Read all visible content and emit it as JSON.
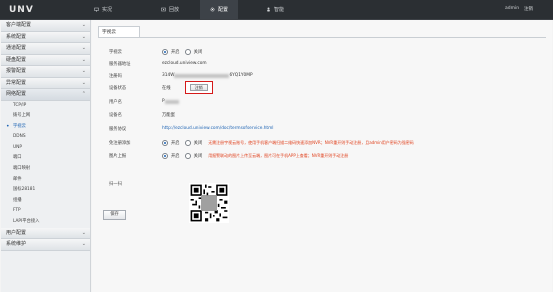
{
  "header": {
    "logo": "UNV",
    "nav": [
      {
        "label": "实况"
      },
      {
        "label": "回放"
      },
      {
        "label": "配置"
      },
      {
        "label": "智能"
      }
    ],
    "user": "admin",
    "logout": "注销"
  },
  "sidebar": {
    "groups_top": [
      "客户端配置",
      "系统配置",
      "通道配置",
      "硬盘配置",
      "报警配置",
      "异常配置",
      "网络配置"
    ],
    "net_items": [
      "TCP/IP",
      "拨号上网",
      "宇视云",
      "DDNS",
      "UNP",
      "端口",
      "端口映射",
      "邮件",
      "国标28181",
      "组播",
      "FTP",
      "LAPI平台接入"
    ],
    "groups_bottom": [
      "用户配置",
      "系统维护"
    ]
  },
  "main": {
    "tab": "宇视云",
    "fields": {
      "cloud_label": "宇视云",
      "on": "开启",
      "off": "关闭",
      "server_label": "服务器地址",
      "server_value": "ezcloud.uniview.com",
      "regcode_label": "注册码",
      "regcode_prefix": "314W",
      "regcode_suffix": "6YQ1Y0MP",
      "status_label": "设备状态",
      "status_value": "在线",
      "unregister": "注销",
      "user_label": "用户名",
      "user_value": "P",
      "devname_label": "设备名",
      "devname_value": "万能蛋",
      "protocol_label": "服务协议",
      "protocol_value": "http://ezcloud.uniview.com/doc/termsofservice.html",
      "free_label": "免注册添加",
      "free_note": "无需注册宇视云账号，使用手机客户端扫描二维码快速添加NVR；NVR重开则手动注册，且admin用户密码为强密码",
      "img_label": "图片上报",
      "img_note": "用报警联动的图片上传至云端，图片可在手机APP上查看；NVR重开则手动注册",
      "scan_label": "扫一扫"
    },
    "save": "保存"
  },
  "colors": {
    "accent": "#1e64b4",
    "highlight": "#d51a1a",
    "note": "#e0401c",
    "topbar": "#2b2f33"
  }
}
